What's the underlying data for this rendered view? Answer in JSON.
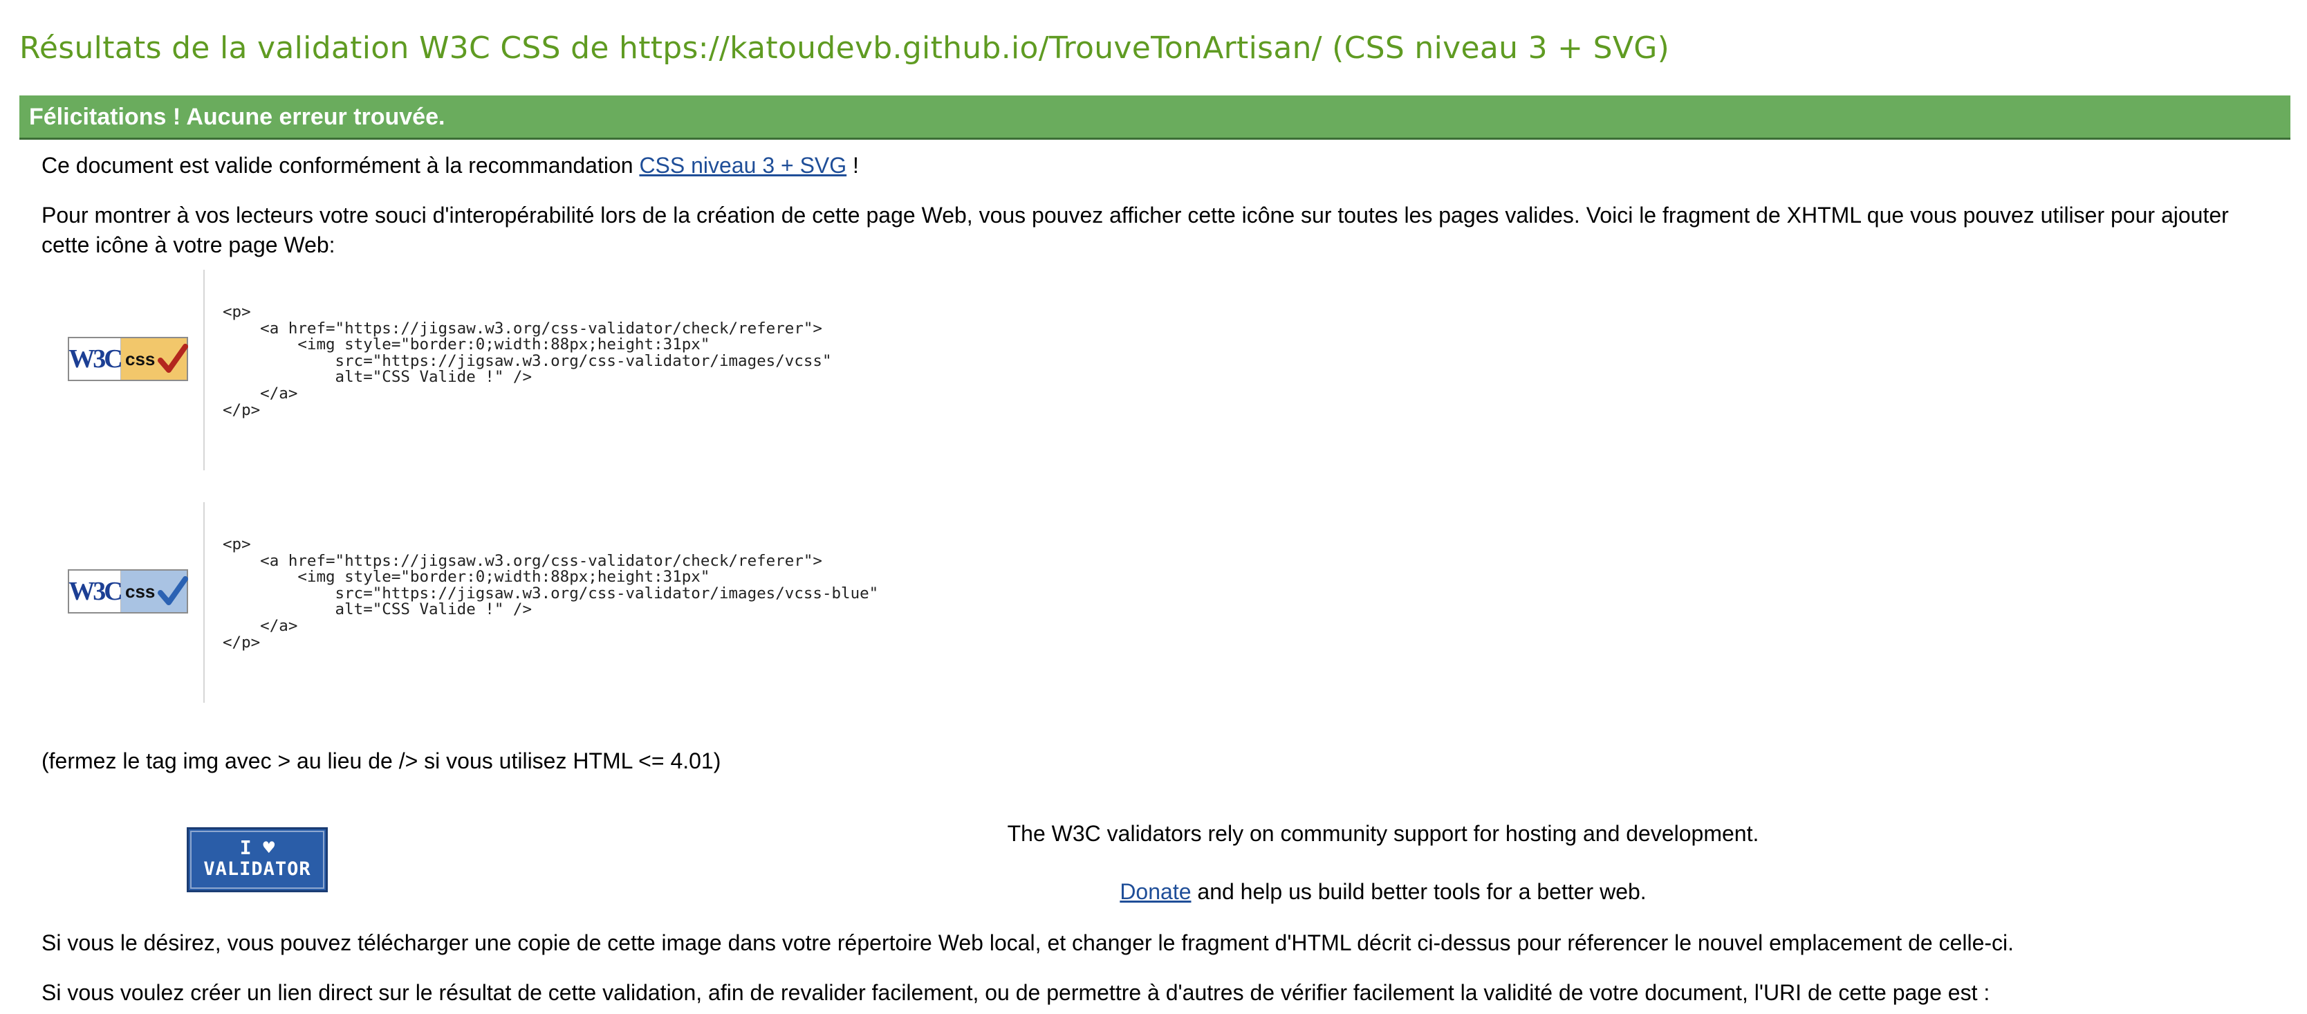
{
  "title": "Résultats de la validation W3C CSS de https://katoudevb.github.io/TrouveTonArtisan/ (CSS niveau 3 + SVG)",
  "banner": "Félicitations ! Aucune erreur trouvée.",
  "valid_line": {
    "prefix": "Ce document est valide conformément à la recommandation",
    "link": "CSS niveau 3 + SVG",
    "suffix": "!"
  },
  "interop_text": "Pour montrer à vos lecteurs votre souci d'interopérabilité lors de la création de cette page Web, vous pouvez afficher cette icône sur toutes les pages valides. Voici le fragment de XHTML que vous pouvez utiliser pour ajouter cette icône à votre page Web:",
  "badges": [
    {
      "w3c": "W3C",
      "css": "css",
      "variant": "gold",
      "code": "<p>\n    <a href=\"https://jigsaw.w3.org/css-validator/check/referer\">\n        <img style=\"border:0;width:88px;height:31px\"\n            src=\"https://jigsaw.w3.org/css-validator/images/vcss\"\n            alt=\"CSS Valide !\" />\n    </a>\n</p>"
    },
    {
      "w3c": "W3C",
      "css": "css",
      "variant": "blue",
      "code": "<p>\n    <a href=\"https://jigsaw.w3.org/css-validator/check/referer\">\n        <img style=\"border:0;width:88px;height:31px\"\n            src=\"https://jigsaw.w3.org/css-validator/images/vcss-blue\"\n            alt=\"CSS Valide !\" />\n    </a>\n</p>"
    }
  ],
  "close_tag_note": "(fermez le tag img avec > au lieu de /> si vous utilisez HTML <= 4.01)",
  "validator_badge": {
    "line1": "I ♥",
    "line2": "VALIDATOR"
  },
  "support": {
    "text": "The W3C validators rely on community support for hosting and development.",
    "donate_link": "Donate",
    "donate_suffix": "and help us build better tools for a better web."
  },
  "download_text": "Si vous le désirez, vous pouvez télécharger une copie de cette image dans votre répertoire Web local, et changer le fragment d'HTML décrit ci-dessus pour réferencer le nouvel emplacement de celle-ci.",
  "uri_text": "Si vous voulez créer un lien direct sur le résultat de cette validation, afin de revalider facilement, ou de permettre à d'autres de vérifier facilement la validité de votre document, l'URI de cette page est :",
  "colors": {
    "title": "#5f9b22",
    "banner": "#6aac5d",
    "link": "#1f4e98",
    "badge_gold": "#f2c76b",
    "badge_blue": "#a9c3e3",
    "check_red": "#b3261e",
    "check_blue": "#2b62b3"
  }
}
